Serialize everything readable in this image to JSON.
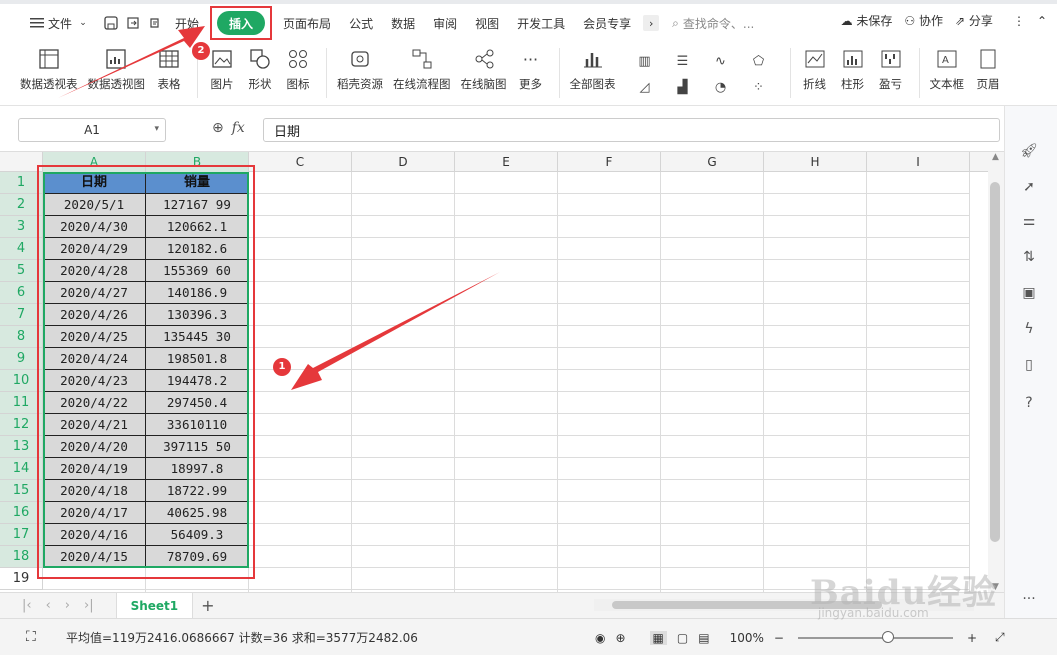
{
  "menubar": {
    "file_label": "文件",
    "tabs": [
      "开始",
      "插入",
      "页面布局",
      "公式",
      "数据",
      "审阅",
      "视图",
      "开发工具",
      "会员专享"
    ],
    "active_tab": "插入",
    "search_placeholder": "查找命令、...",
    "unsaved": "未保存",
    "collaborate": "协作",
    "share": "分享"
  },
  "ribbon": {
    "buttons": [
      "数据透视表",
      "数据透视图",
      "表格",
      "图片",
      "形状",
      "图标",
      "稻壳资源",
      "在线流程图",
      "在线脑图",
      "更多"
    ],
    "all_charts": "全部图表",
    "small_charts": [
      "折线",
      "柱形",
      "盈亏"
    ],
    "textbox": "文本框",
    "header_footer": "页眉"
  },
  "formulabar": {
    "namebox": "A1",
    "fx": "fx",
    "content": "日期"
  },
  "columns": [
    "A",
    "B",
    "C",
    "D",
    "E",
    "F",
    "G",
    "H",
    "I"
  ],
  "table": {
    "headers": [
      "日期",
      "销量"
    ],
    "rows": [
      [
        "2020/5/1",
        "127167 99"
      ],
      [
        "2020/4/30",
        "120662.1"
      ],
      [
        "2020/4/29",
        "120182.6"
      ],
      [
        "2020/4/28",
        "155369 60"
      ],
      [
        "2020/4/27",
        "140186.9"
      ],
      [
        "2020/4/26",
        "130396.3"
      ],
      [
        "2020/4/25",
        "135445 30"
      ],
      [
        "2020/4/24",
        "198501.8"
      ],
      [
        "2020/4/23",
        "194478.2"
      ],
      [
        "2020/4/22",
        "297450.4"
      ],
      [
        "2020/4/21",
        "33610110"
      ],
      [
        "2020/4/20",
        "397115 50"
      ],
      [
        "2020/4/19",
        "18997.8"
      ],
      [
        "2020/4/18",
        "18722.99"
      ],
      [
        "2020/4/17",
        "40625.98"
      ],
      [
        "2020/4/16",
        "56409.3"
      ],
      [
        "2020/4/15",
        "78709.69"
      ]
    ]
  },
  "row_numbers": [
    "1",
    "2",
    "3",
    "4",
    "5",
    "6",
    "7",
    "8",
    "9",
    "10",
    "11",
    "12",
    "13",
    "14",
    "15",
    "16",
    "17",
    "18",
    "19"
  ],
  "sheet": {
    "name": "Sheet1"
  },
  "status": {
    "summary": "平均值=119万2416.0686667  计数=36  求和=3577万2482.06",
    "zoom": "100%"
  },
  "annotations": {
    "badge1": "1",
    "badge2": "2"
  },
  "watermark": {
    "brand": "Baidu经验",
    "url": "jingyan.baidu.com"
  },
  "colors": {
    "accent": "#1fa863",
    "annotation": "#e5383b",
    "header_fill": "#5b8fce"
  }
}
